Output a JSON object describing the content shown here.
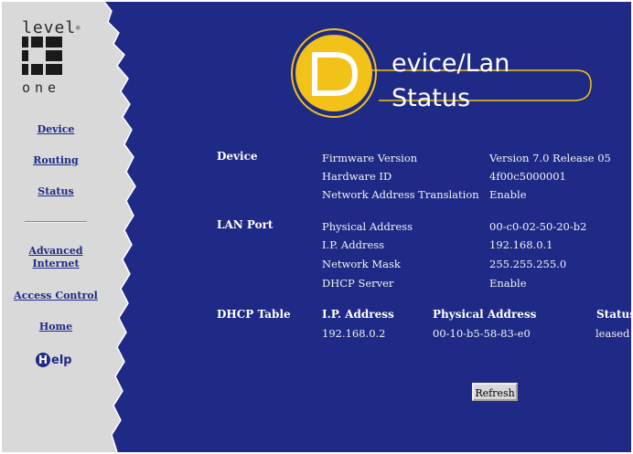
{
  "brand": {
    "logo_top": "level",
    "logo_bottom": "one"
  },
  "nav": {
    "device": "Device",
    "routing": "Routing",
    "status": "Status",
    "advanced_line1": "Advanced",
    "advanced_line2": "Internet",
    "access_control": "Access Control",
    "home": "Home",
    "help_letter": "H",
    "help_rest": "elp"
  },
  "banner": {
    "letter": "D",
    "line1": "evice/Lan",
    "line2": "Status"
  },
  "device": {
    "title": "Device",
    "rows": [
      {
        "label": "Firmware Version",
        "value": "Version 7.0 Release 05"
      },
      {
        "label": "Hardware ID",
        "value": "4f00c5000001"
      },
      {
        "label": "Network Address Translation",
        "value": "Enable"
      }
    ]
  },
  "lan": {
    "title": "LAN Port",
    "rows": [
      {
        "label": "Physical Address",
        "value": "00-c0-02-50-20-b2"
      },
      {
        "label": "I.P. Address",
        "value": "192.168.0.1"
      },
      {
        "label": "Network Mask",
        "value": "255.255.255.0"
      },
      {
        "label": "DHCP Server",
        "value": "Enable"
      }
    ]
  },
  "dhcp": {
    "title": "DHCP Table",
    "headers": [
      "I.P. Address",
      "Physical Address",
      "Status"
    ],
    "rows": [
      [
        "192.168.0.2",
        "00-10-b5-58-83-e0",
        "leased"
      ]
    ]
  },
  "refresh_label": "Refresh",
  "colors": {
    "background": "#1f2a86",
    "sidebar": "#d9d9d9",
    "accent": "#f2c218"
  }
}
